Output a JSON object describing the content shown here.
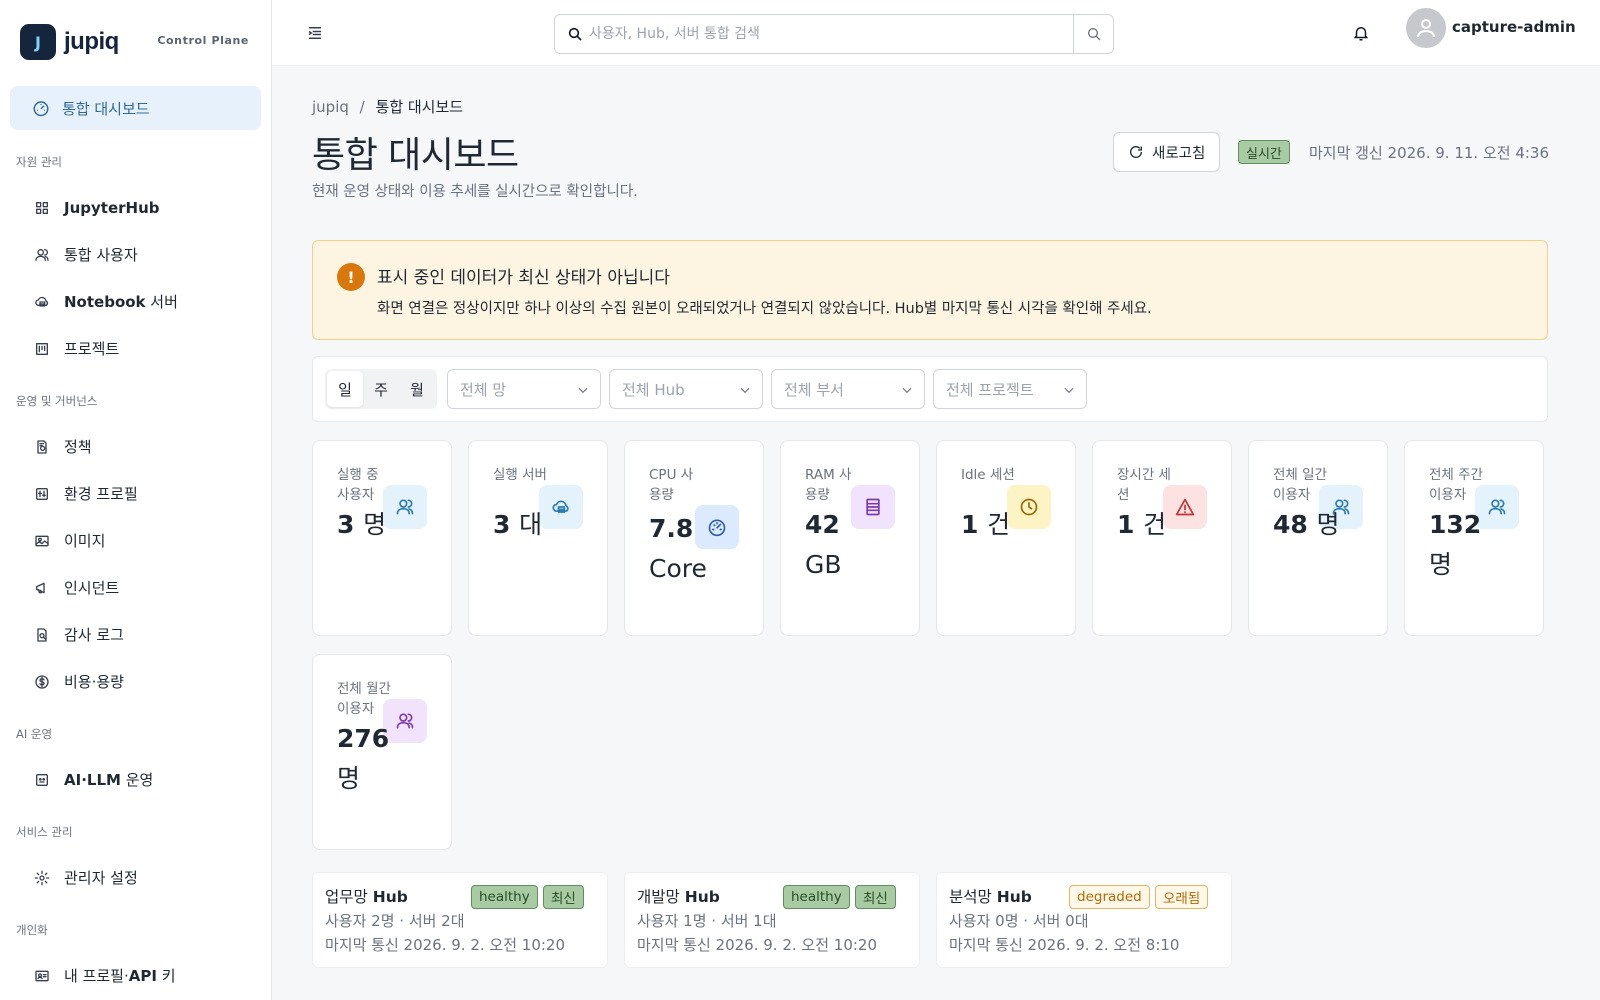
{
  "brand": {
    "name": "jupiq",
    "subtitle": "Control Plane",
    "logo_letter": "J"
  },
  "sidebar": {
    "active": {
      "label": "통합 대시보드",
      "icon": "dashboard-icon"
    },
    "sections": [
      {
        "title": "자원 관리",
        "items": [
          {
            "label": "JupyterHub",
            "icon": "grid-icon",
            "bold": true
          },
          {
            "label": "통합 사용자",
            "icon": "users-icon",
            "bold": false
          },
          {
            "label": "Notebook 서버",
            "icon": "cloud-server-icon",
            "bold_part": "Notebook",
            "rest": " 서버"
          },
          {
            "label": "프로젝트",
            "icon": "project-icon",
            "bold": false
          }
        ]
      },
      {
        "title": "운영 및 거버넌스",
        "items": [
          {
            "label": "정책",
            "icon": "policy-icon"
          },
          {
            "label": "환경 프로필",
            "icon": "sliders-icon"
          },
          {
            "label": "이미지",
            "icon": "image-icon"
          },
          {
            "label": "인시던트",
            "icon": "megaphone-icon"
          },
          {
            "label": "감사 로그",
            "icon": "audit-icon"
          },
          {
            "label": "비용·용량",
            "icon": "dollar-icon"
          }
        ]
      },
      {
        "title": "AI 운영",
        "items": [
          {
            "label": "AI·LLM 운영",
            "icon": "ai-icon",
            "bold_part": "AI·LLM",
            "rest": " 운영"
          }
        ]
      },
      {
        "title": "서비스 관리",
        "items": [
          {
            "label": "관리자 설정",
            "icon": "gear-icon"
          }
        ]
      },
      {
        "title": "개인화",
        "items": [
          {
            "label": "내 프로필·API 키",
            "icon": "id-card-icon",
            "bold_part": "API",
            "pre": "내 프로필·",
            "rest": " 키"
          }
        ]
      }
    ]
  },
  "topbar": {
    "search_placeholder": "사용자, Hub, 서버 통합 검색",
    "username": "capture-admin"
  },
  "breadcrumb": {
    "root": "jupiq",
    "separator": "/",
    "current": "통합 대시보드"
  },
  "page": {
    "title": "통합 대시보드",
    "subtitle": "현재 운영 상태와 이용 추세를 실시간으로 확인합니다.",
    "refresh_label": "새로고침",
    "live_badge": "실시간",
    "last_update": "마지막 갱신 2026. 9. 11. 오전 4:36"
  },
  "alert": {
    "icon": "!",
    "title": "표시 중인 데이터가 최신 상태가 아닙니다",
    "message": "화면 연결은 정상이지만 하나 이상의 수집 원본이 오래되었거나 연결되지 않았습니다. Hub별 마지막 통신 시각을 확인해 주세요."
  },
  "filters": {
    "periods": [
      "일",
      "주",
      "월"
    ],
    "selected_period": "일",
    "selects": [
      "전체 망",
      "전체 Hub",
      "전체 부서",
      "전체 프로젝트"
    ]
  },
  "metrics": [
    {
      "label": "실행 중 사용자",
      "value": "3",
      "unit": "명",
      "icon": "users-icon",
      "icon_bg": "#e3f2fb",
      "icon_color": "#2a7bb0"
    },
    {
      "label": "실행 서버",
      "value": "3",
      "unit": "대",
      "icon": "cloud-server-icon",
      "icon_bg": "#e3f2fb",
      "icon_color": "#2a7bb0"
    },
    {
      "label": "CPU 사용량",
      "value": "7.8",
      "unit": "Core",
      "icon": "gauge-icon",
      "icon_bg": "#dbeafe",
      "icon_color": "#2f5fa8"
    },
    {
      "label": "RAM 사용량",
      "value": "42",
      "unit": "GB",
      "icon": "memory-icon",
      "icon_bg": "#f0e3fb",
      "icon_color": "#7c3aad"
    },
    {
      "label": "Idle 세션",
      "value": "1",
      "unit": "건",
      "icon": "clock-icon",
      "icon_bg": "#fdf3c4",
      "icon_color": "#9a6a00"
    },
    {
      "label": "장시간 세션",
      "value": "1",
      "unit": "건",
      "icon": "warning-icon",
      "icon_bg": "#fde2e2",
      "icon_color": "#c53030"
    },
    {
      "label": "전체 일간 이용자",
      "value": "48",
      "unit": "명",
      "icon": "users-icon",
      "icon_bg": "#e3f2fb",
      "icon_color": "#2a7bb0"
    },
    {
      "label": "전체 주간 이용자",
      "value": "132",
      "unit": "명",
      "icon": "users-icon",
      "icon_bg": "#e3f2fb",
      "icon_color": "#2a7bb0"
    },
    {
      "label": "전체 월간 이용자",
      "value": "276",
      "unit": "명",
      "icon": "users-icon",
      "icon_bg": "#f0e3fb",
      "icon_color": "#7c3aad"
    }
  ],
  "hubs": [
    {
      "name_pre": "업무망",
      "name_bold": "Hub",
      "status": "healthy",
      "freshness": "최신",
      "status_tone": "green",
      "stats": "사용자 2명 · 서버 2대",
      "last_comm": "마지막 통신 2026. 9. 2. 오전 10:20"
    },
    {
      "name_pre": "개발망",
      "name_bold": "Hub",
      "status": "healthy",
      "freshness": "최신",
      "status_tone": "green",
      "stats": "사용자 1명 · 서버 1대",
      "last_comm": "마지막 통신 2026. 9. 2. 오전 10:20"
    },
    {
      "name_pre": "분석망",
      "name_bold": "Hub",
      "status": "degraded",
      "freshness": "오래됨",
      "status_tone": "orange",
      "stats": "사용자 0명 · 서버 0대",
      "last_comm": "마지막 통신 2026. 9. 2. 오전 8:10"
    }
  ]
}
